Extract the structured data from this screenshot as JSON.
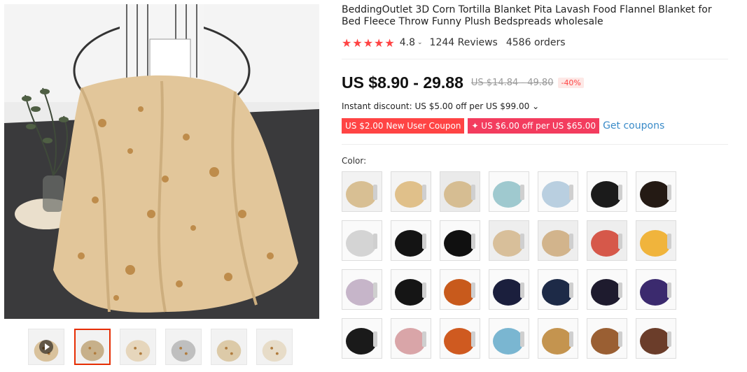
{
  "product": {
    "title": "BeddingOutlet 3D Corn Tortilla Blanket Pita Lavash Food Flannel Blanket for Bed Fleece Throw Funny Plush Bedspreads wholesale",
    "rating": {
      "stars": "★★★★★",
      "score": "4.8",
      "reviews": "1244 Reviews",
      "orders": "4586 orders"
    },
    "price": "US $8.90 - 29.88",
    "old_price": "US $14.84 - 49.80",
    "discount": "-40%",
    "instant_discount": "Instant discount: US $5.00 off per US $99.00 ⌄",
    "coupons": [
      "US $2.00 New User Coupon",
      "✦ US $6.00 off per US $65.00"
    ],
    "get_coupons": "Get coupons",
    "color_label": "Color:"
  },
  "colors": {
    "accent": "#e62e04",
    "star": "#ff4747",
    "coupon1": "#ff4747",
    "coupon2": "#f33c5e",
    "link": "#3a8bc8"
  },
  "thumbnails": [
    {
      "icon": "video-thumb-icon",
      "video": true
    },
    {
      "icon": "blanket-chair-thumb-icon",
      "active": true
    },
    {
      "icon": "size-comparison-thumb-icon"
    },
    {
      "icon": "wrapped-person-thumb-icon"
    },
    {
      "icon": "folded-blanket-thumb-icon"
    },
    {
      "icon": "collage-thumb-icon"
    }
  ],
  "color_options": [
    "tortilla-black-bg",
    "tortilla-round",
    "tortilla-person",
    "unicorn-watercolor",
    "dolphin-sketch",
    "black-butterfly",
    "black-floral",
    "compass",
    "skull-floral",
    "horses-black",
    "beige-round-a",
    "beige-round-b",
    "pizza",
    "egg",
    "mandala-pastel",
    "unicorn-black",
    "african-woman",
    "dreamcatcher-dark",
    "dreamcatcher-blue",
    "dragonfly",
    "galaxy-unicorn",
    "chakra-rainbow",
    "floral-pink",
    "orange-dark-moon",
    "blue-mandala",
    "egypt-pattern",
    "brown-dreamcatcher",
    "native-woman"
  ]
}
